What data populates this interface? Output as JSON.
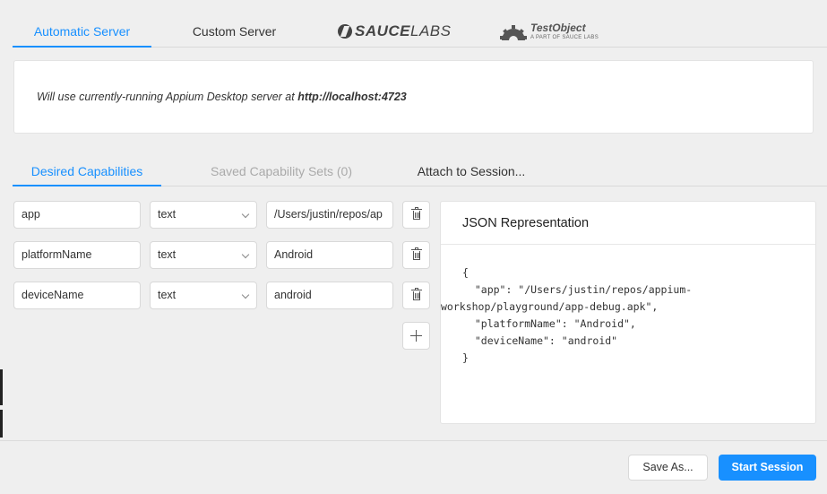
{
  "server_tabs": [
    {
      "label": "Automatic Server",
      "active": true
    },
    {
      "label": "Custom Server",
      "active": false
    }
  ],
  "logos": {
    "saucelabs_bold": "SAUCE",
    "saucelabs_light": "LABS",
    "testobject_title": "TestObject",
    "testobject_subtitle": "A PART OF SAUCE LABS"
  },
  "server_info": {
    "prefix": "Will use currently-running Appium Desktop server at ",
    "url": "http://localhost:4723"
  },
  "capability_tabs": [
    {
      "label": "Desired Capabilities",
      "active": true
    },
    {
      "label": "Saved Capability Sets (0)",
      "disabled": true
    },
    {
      "label": "Attach to Session...",
      "active": false
    }
  ],
  "capabilities": [
    {
      "name": "app",
      "type": "text",
      "value": "/Users/justin/repos/ap"
    },
    {
      "name": "platformName",
      "type": "text",
      "value": "Android"
    },
    {
      "name": "deviceName",
      "type": "text",
      "value": "android"
    }
  ],
  "json_panel": {
    "title": "JSON Representation",
    "lines": [
      "{",
      "  \"app\": \"/Users/justin/repos/appium-",
      "workshop/playground/app-debug.apk\",",
      "  \"platformName\": \"Android\",",
      "  \"deviceName\": \"android\"",
      "}"
    ]
  },
  "footer": {
    "save_as_label": "Save As...",
    "start_session_label": "Start Session"
  },
  "colors": {
    "accent": "#1890ff",
    "background": "#efefef"
  }
}
